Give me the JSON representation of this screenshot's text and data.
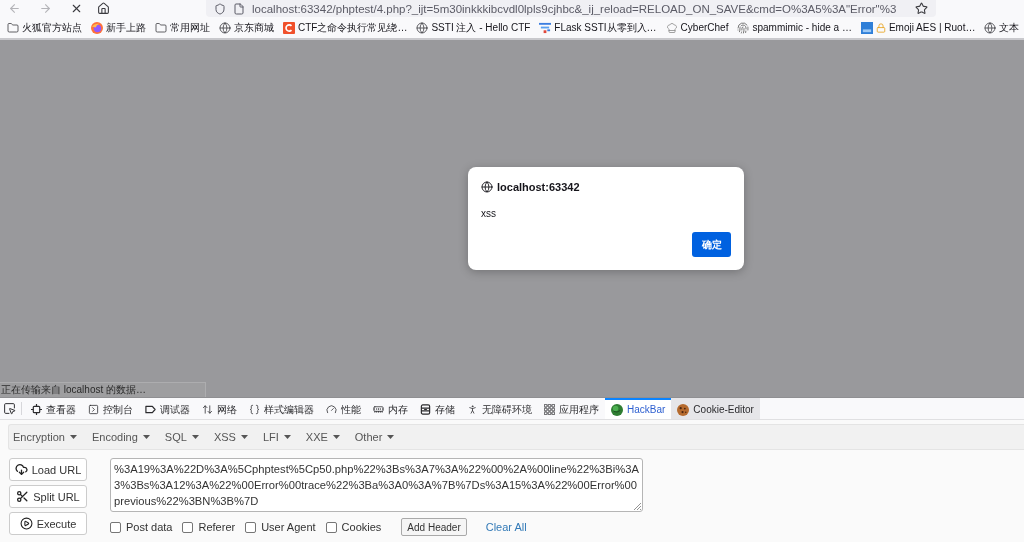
{
  "browser": {
    "url": "localhost:63342/phptest/4.php?_ijt=5m30inkkkibcvdl0lpls9cjhbc&_ij_reload=RELOAD_ON_SAVE&cmd=O%3A5%3A\"Error\"%3",
    "bookmarks": [
      {
        "kind": "folder",
        "label": "火狐官方站点"
      },
      {
        "kind": "browser",
        "label": "新手上路"
      },
      {
        "kind": "folder",
        "label": "常用网址"
      },
      {
        "kind": "globe",
        "label": "京东商城"
      },
      {
        "kind": "letter",
        "label": "CTF之命令执行常见绕…"
      },
      {
        "kind": "globe",
        "label": "SSTI 注入 - Hello CTF"
      },
      {
        "kind": "bars",
        "label": "FLask SSTI从零到入…"
      },
      {
        "kind": "chef",
        "label": "CyberChef"
      },
      {
        "kind": "fingerprint",
        "label": "spammimic - hide a …"
      },
      {
        "kind": "secure",
        "label": "Emoji AES | Ruot…"
      },
      {
        "kind": "globe",
        "label": "文本"
      }
    ]
  },
  "page": {
    "status": "正在传输来自 localhost 的数据…"
  },
  "dialog": {
    "origin": "localhost:63342",
    "message": "xss",
    "button": "确定"
  },
  "devtools": {
    "tabs": [
      {
        "kind": "inspector",
        "label": "查看器",
        "selected": false,
        "hovered": false
      },
      {
        "kind": "console",
        "label": "控制台",
        "selected": false,
        "hovered": false
      },
      {
        "kind": "debugger",
        "label": "调试器",
        "selected": false,
        "hovered": false
      },
      {
        "kind": "network",
        "label": "网络",
        "selected": false,
        "hovered": false
      },
      {
        "kind": "style",
        "label": "样式编辑器",
        "selected": false,
        "hovered": false
      },
      {
        "kind": "performance",
        "label": "性能",
        "selected": false,
        "hovered": false
      },
      {
        "kind": "memory",
        "label": "内存",
        "selected": false,
        "hovered": false
      },
      {
        "kind": "storage",
        "label": "存储",
        "selected": false,
        "hovered": false
      },
      {
        "kind": "accessibility",
        "label": "无障碍环境",
        "selected": false,
        "hovered": false
      },
      {
        "kind": "application",
        "label": "应用程序",
        "selected": false,
        "hovered": false
      },
      {
        "kind": "hackbar",
        "label": "HackBar",
        "selected": true,
        "hovered": false
      },
      {
        "kind": "cookie",
        "label": "Cookie-Editor",
        "selected": false,
        "hovered": true
      }
    ]
  },
  "hackbar": {
    "menus": [
      "Encryption",
      "Encoding",
      "SQL",
      "XSS",
      "LFI",
      "XXE",
      "Other"
    ],
    "buttons": [
      {
        "kind": "load",
        "label": "Load URL"
      },
      {
        "kind": "split",
        "label": "Split URL"
      },
      {
        "kind": "execute",
        "label": "Execute"
      }
    ],
    "url_value": "%3A19%3A%22D%3A%5Cphptest%5Cp50.php%22%3Bs%3A7%3A%22%00%2A%00line%22%3Bi%3A3%3Bs%3A12%3A%22%00Error%00trace%22%3Ba%3A0%3A%7B%7Ds%3A15%3A%22%00Error%00previous%22%3BN%3B%7D",
    "options": [
      {
        "label": "Post data",
        "checked": false
      },
      {
        "label": "Referer",
        "checked": false
      },
      {
        "label": "User Agent",
        "checked": false
      },
      {
        "label": "Cookies",
        "checked": false
      }
    ],
    "add_header": "Add Header",
    "clear_all": "Clear All"
  }
}
